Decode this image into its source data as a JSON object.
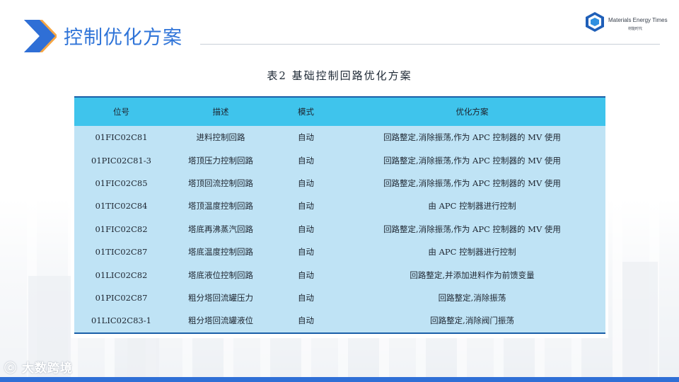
{
  "slide": {
    "title": "控制优化方案",
    "accent_color": "#2f74d8",
    "chevron_colors": [
      "#2f6fd6",
      "#f5a13a"
    ]
  },
  "logo": {
    "name": "Materials Energy Times",
    "subtitle": "材能时代",
    "icon": "cube-logo-icon"
  },
  "table": {
    "caption": "表2   基础控制回路优化方案",
    "header_color": "#3fc4ec",
    "row_color": "#bfe3f5",
    "columns": [
      "位号",
      "描述",
      "模式",
      "优化方案"
    ],
    "rows": [
      [
        "01FIC02C81",
        "进料控制回路",
        "自动",
        "回路整定,消除振荡,作为 APC 控制器的 MV 使用"
      ],
      [
        "01PIC02C81-3",
        "塔顶压力控制回路",
        "自动",
        "回路整定,消除振荡,作为 APC 控制器的 MV 使用"
      ],
      [
        "01FIC02C85",
        "塔顶回流控制回路",
        "自动",
        "回路整定,消除振荡,作为 APC 控制器的 MV 使用"
      ],
      [
        "01TIC02C84",
        "塔顶温度控制回路",
        "自动",
        "由 APC 控制器进行控制"
      ],
      [
        "01FIC02C82",
        "塔底再沸蒸汽回路",
        "自动",
        "回路整定,消除振荡,作为 APC 控制器的 MV 使用"
      ],
      [
        "01TIC02C87",
        "塔底温度控制回路",
        "自动",
        "由 APC 控制器进行控制"
      ],
      [
        "01LIC02C82",
        "塔底液位控制回路",
        "自动",
        "回路整定,并添加进料作为前馈变量"
      ],
      [
        "01PIC02C87",
        "粗分塔回流罐压力",
        "自动",
        "回路整定,消除振荡"
      ],
      [
        "01LIC02C83-1",
        "粗分塔回流罐液位",
        "自动",
        "回路整定,消除阀门振荡"
      ]
    ]
  },
  "watermark": {
    "text": "大数跨境",
    "icon": "logo-mark-icon"
  }
}
